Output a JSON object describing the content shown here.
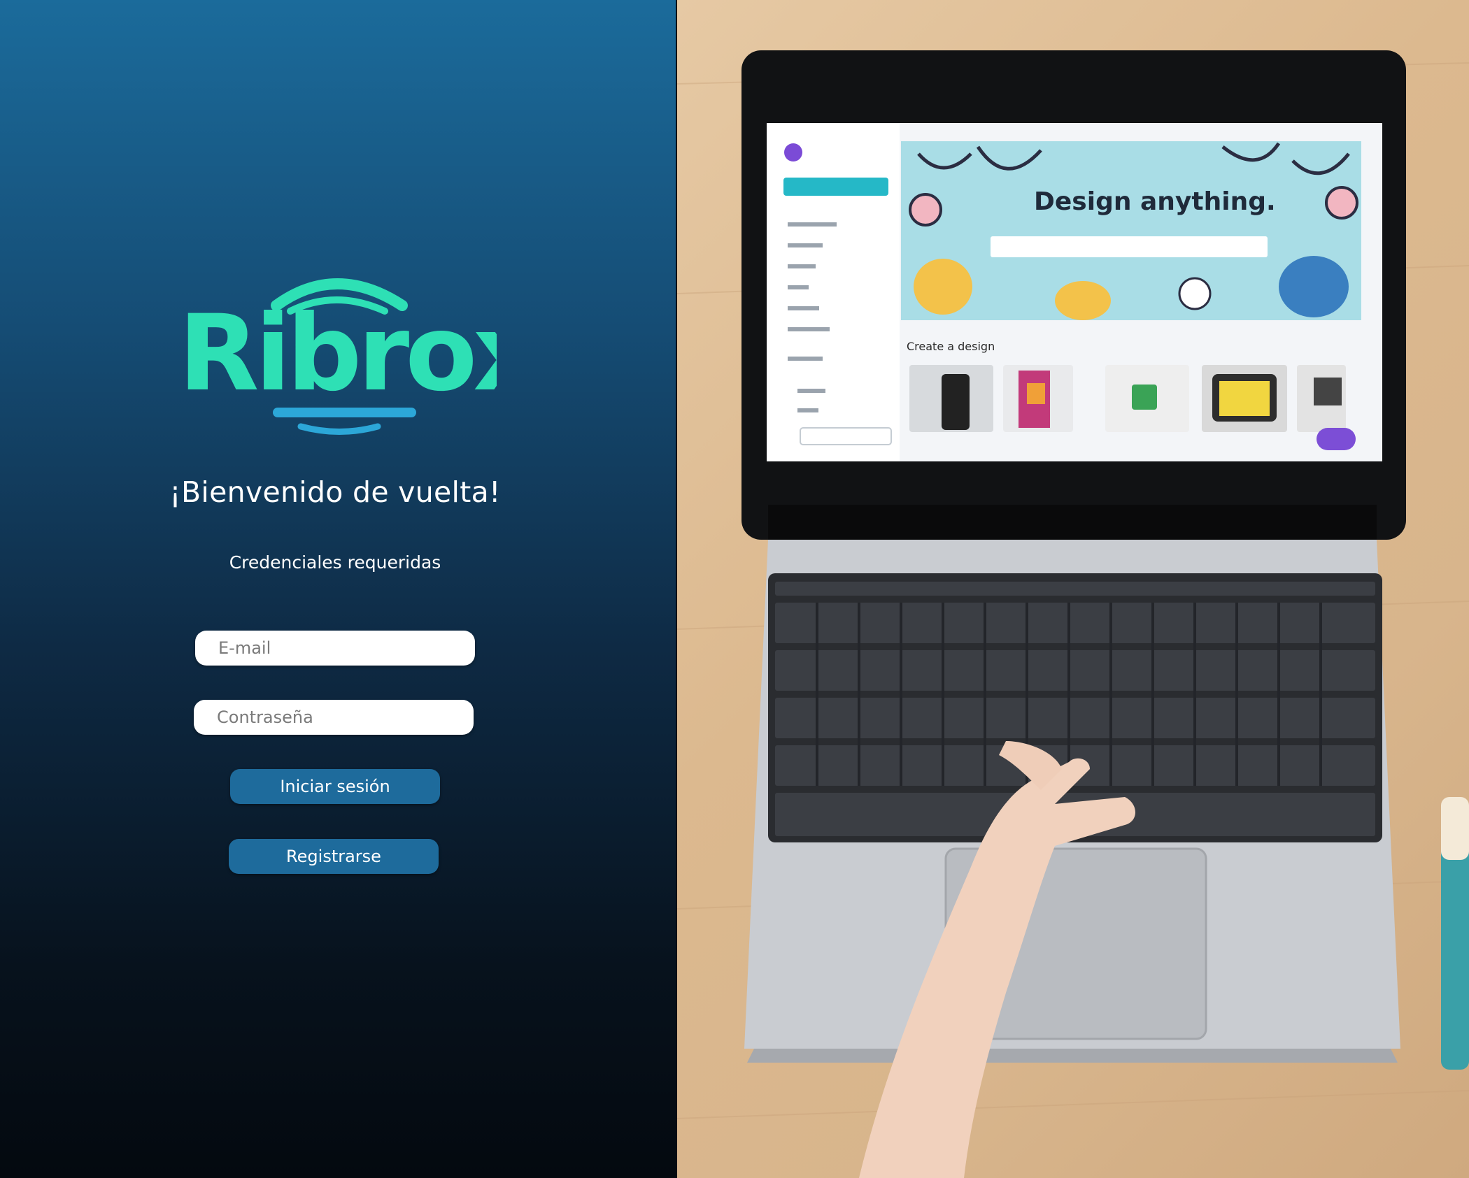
{
  "brand": {
    "logo_text": "Ribrox",
    "accent_color": "#2ee0b5",
    "secondary_color": "#2ca7d8"
  },
  "login": {
    "welcome": "¡Bienvenido de vuelta!",
    "subtitle": "Credenciales requeridas",
    "email_placeholder": "E-mail",
    "password_placeholder": "Contraseña",
    "login_button": "Iniciar sesión",
    "register_button": "Registrarse",
    "button_color": "#1e6b9c"
  },
  "photo": {
    "screen_headline": "Design anything.",
    "screen_section": "Create a design"
  }
}
